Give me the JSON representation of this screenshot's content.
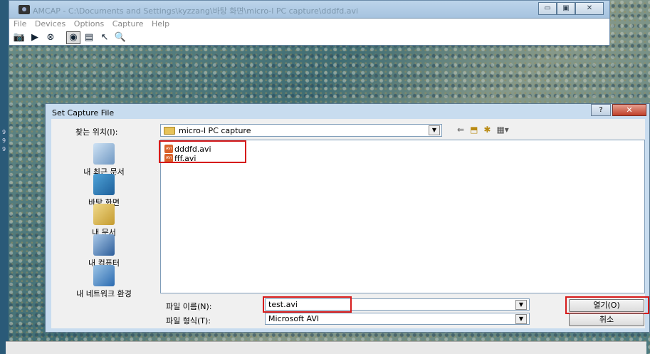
{
  "amcap": {
    "title": "AMCAP - C:\\Documents and Settings\\kyzzang\\바탕 화면\\micro-l PC capture\\dddfd.avi",
    "menu": [
      "File",
      "Devices",
      "Options",
      "Capture",
      "Help"
    ],
    "window_buttons": {
      "minimize": "▭",
      "maximize": "▣",
      "close": "✕"
    }
  },
  "dialog": {
    "title": "Set Capture File",
    "help": "?",
    "close": "✕",
    "look_in_label": "찾는 위치(I):",
    "look_in_value": "micro-l PC capture",
    "places": [
      "내 최근 문서",
      "바탕 화면",
      "내 문서",
      "내 컴퓨터",
      "내 네트워크 환경"
    ],
    "files": [
      "dddfd.avi",
      "fff.avi"
    ],
    "file_name_label": "파일 이름(N):",
    "file_name_value": "test.avi",
    "file_type_label": "파일 형식(T):",
    "file_type_value": "Microsoft AVI",
    "open_button": "열기(O)",
    "cancel_button": "취소"
  },
  "side_text": [
    "9",
    "9",
    "9"
  ],
  "colors": {
    "highlight": "#d61b1b",
    "title_bar": "#bcd4ea",
    "dialog_frame": "#c8dcef"
  }
}
